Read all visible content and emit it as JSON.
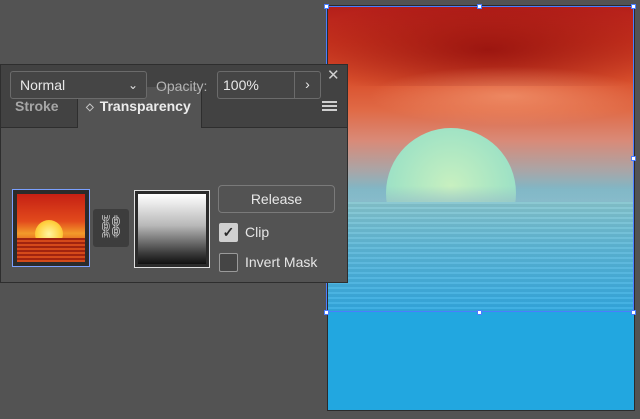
{
  "panel": {
    "collapse_glyph": "‹‹",
    "close_glyph": "✕",
    "tabs": [
      {
        "label": "Stroke",
        "active": false
      },
      {
        "label": "Transparency",
        "active": true
      }
    ],
    "tab_updown_glyph": "◇",
    "blend_mode": {
      "value": "Normal",
      "chevron": "⌄"
    },
    "opacity": {
      "label": "Opacity:",
      "value": "100%",
      "arrow": "›"
    },
    "link_glyph": "⛓",
    "release_label": "Release",
    "clip": {
      "label": "Clip",
      "checked": true,
      "check_glyph": "✓"
    },
    "invert_mask": {
      "label": "Invert Mask",
      "checked": false
    }
  },
  "icons": {
    "collapse": "double-chevron-left-icon",
    "close": "close-icon",
    "panel_menu": "hamburger-menu-icon",
    "link": "chain-link-icon",
    "dropdown": "chevron-down-icon",
    "opacity_arrow": "chevron-right-icon"
  },
  "colors": {
    "background": "#535353",
    "panel_header": "#424242",
    "selection": "#4a7dff",
    "artboard_fill": "#22a7e0"
  }
}
